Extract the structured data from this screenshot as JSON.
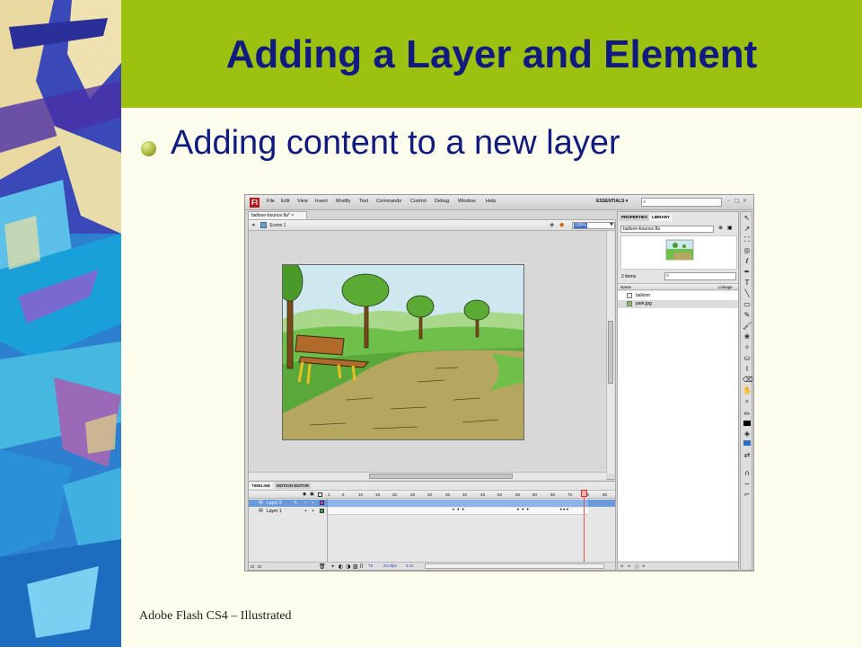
{
  "slide": {
    "title": "Adding a Layer and Element",
    "bullet": "Adding content to a new layer",
    "footer": "Adobe Flash CS4 – Illustrated"
  },
  "app": {
    "icon_letter": "Fl",
    "menus": [
      "File",
      "Edit",
      "View",
      "Insert",
      "Modify",
      "Text",
      "Commands",
      "Control",
      "Debug",
      "Window",
      "Help"
    ],
    "workspace": "ESSENTIALS ▾",
    "document_tab": "balloon-bounce.fla* ×",
    "scene": "Scene 1",
    "zoom": "100%",
    "timeline_tabs": [
      "TIMELINE",
      "MOTION EDITOR"
    ],
    "frame_numbers": [
      "1",
      "5",
      "10",
      "15",
      "20",
      "25",
      "30",
      "35",
      "40",
      "45",
      "50",
      "55",
      "60",
      "65",
      "70",
      "75",
      "80"
    ],
    "layers": [
      {
        "name": "Layer 2",
        "selected": true,
        "color": "#c040c0"
      },
      {
        "name": "Layer 1",
        "selected": false,
        "color": "#3fae3f"
      }
    ],
    "timeline_status": {
      "frame": "75",
      "fps": "24.0fps",
      "time": "3.1s"
    },
    "panel_tabs": [
      "PROPERTIES",
      "LIBRARY"
    ],
    "library": {
      "file": "balloon-bounce.fla",
      "item_count": "2 items",
      "columns": {
        "name": "Name",
        "linkage": "Linkage"
      },
      "items": [
        {
          "name": "balloon",
          "type": "symbol"
        },
        {
          "name": "park.jpg",
          "type": "bitmap"
        }
      ]
    },
    "tools": [
      "selection-tool",
      "subselection-tool",
      "free-transform-tool",
      "3d-rotation-tool",
      "lasso-tool",
      "pen-tool",
      "text-tool",
      "line-tool",
      "rectangle-tool",
      "pencil-tool",
      "brush-tool",
      "deco-tool",
      "bone-tool",
      "paint-bucket-tool",
      "eyedropper-tool",
      "eraser-tool",
      "hand-tool",
      "zoom-tool",
      "stroke-color",
      "fill-color",
      "swap-colors",
      "snap-tool",
      "smooth-tool",
      "straighten-tool"
    ]
  }
}
